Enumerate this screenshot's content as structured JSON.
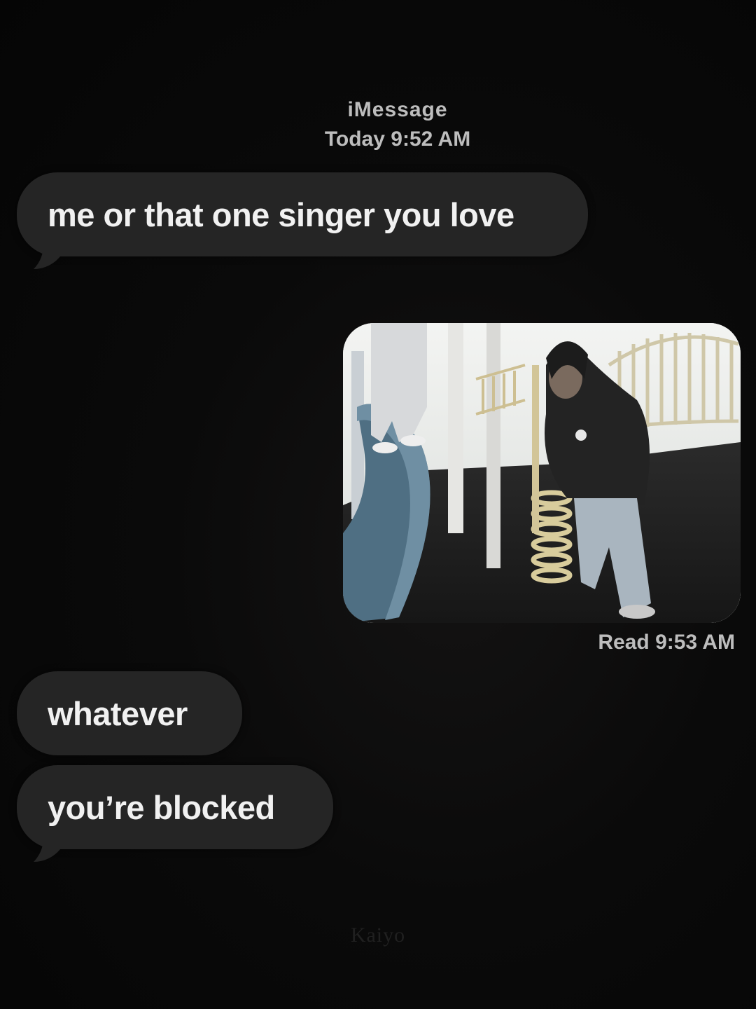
{
  "header": {
    "service": "iMessage",
    "timestamp": "Today 9:52 AM"
  },
  "messages": [
    {
      "direction": "received",
      "text": "me or that one singer you love"
    },
    {
      "direction": "sent",
      "type": "photo",
      "icon": "photo-attachment"
    },
    {
      "direction": "received",
      "text": "whatever"
    },
    {
      "direction": "received",
      "text": "you’re blocked"
    }
  ],
  "read_receipt": "Read 9:53 AM",
  "watermark": "Kaiyo",
  "colors": {
    "background": "#060606",
    "bubble_received": "#252525",
    "text": "#f1f1f1",
    "meta_text": "#bdbdbd"
  }
}
